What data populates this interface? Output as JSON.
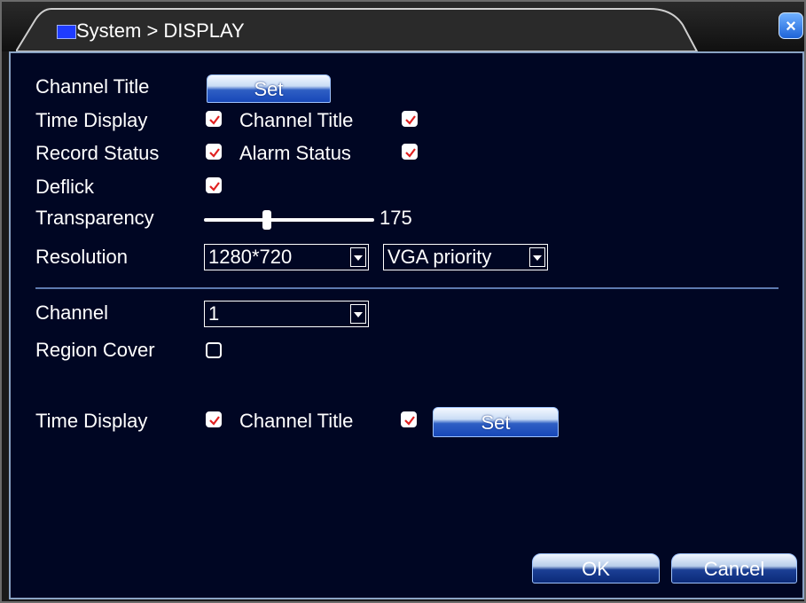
{
  "window": {
    "title": "System > DISPLAY",
    "close_label": "×"
  },
  "settings": {
    "channel_title_label": "Channel Title",
    "channel_title_set_label": "Set",
    "time_display_label": "Time Display",
    "time_display_checked": true,
    "channel_title_check_label": "Channel Title",
    "channel_title_checked": true,
    "record_status_label": "Record Status",
    "record_status_checked": true,
    "alarm_status_label": "Alarm Status",
    "alarm_status_checked": true,
    "deflick_label": "Deflick",
    "deflick_checked": true,
    "transparency_label": "Transparency",
    "transparency_value": "175",
    "transparency_fraction": 0.36,
    "resolution_label": "Resolution",
    "resolution_value": "1280*720",
    "output_priority_value": "VGA priority"
  },
  "channel_section": {
    "channel_label": "Channel",
    "channel_value": "1",
    "region_cover_label": "Region Cover",
    "region_cover_checked": false,
    "time_display_label": "Time Display",
    "time_display_checked": true,
    "channel_title_label": "Channel Title",
    "channel_title_checked": true,
    "set_label": "Set"
  },
  "footer": {
    "ok_label": "OK",
    "cancel_label": "Cancel"
  },
  "colors": {
    "background": "#000623",
    "accent": "#1747b8",
    "check": "#e02020"
  }
}
